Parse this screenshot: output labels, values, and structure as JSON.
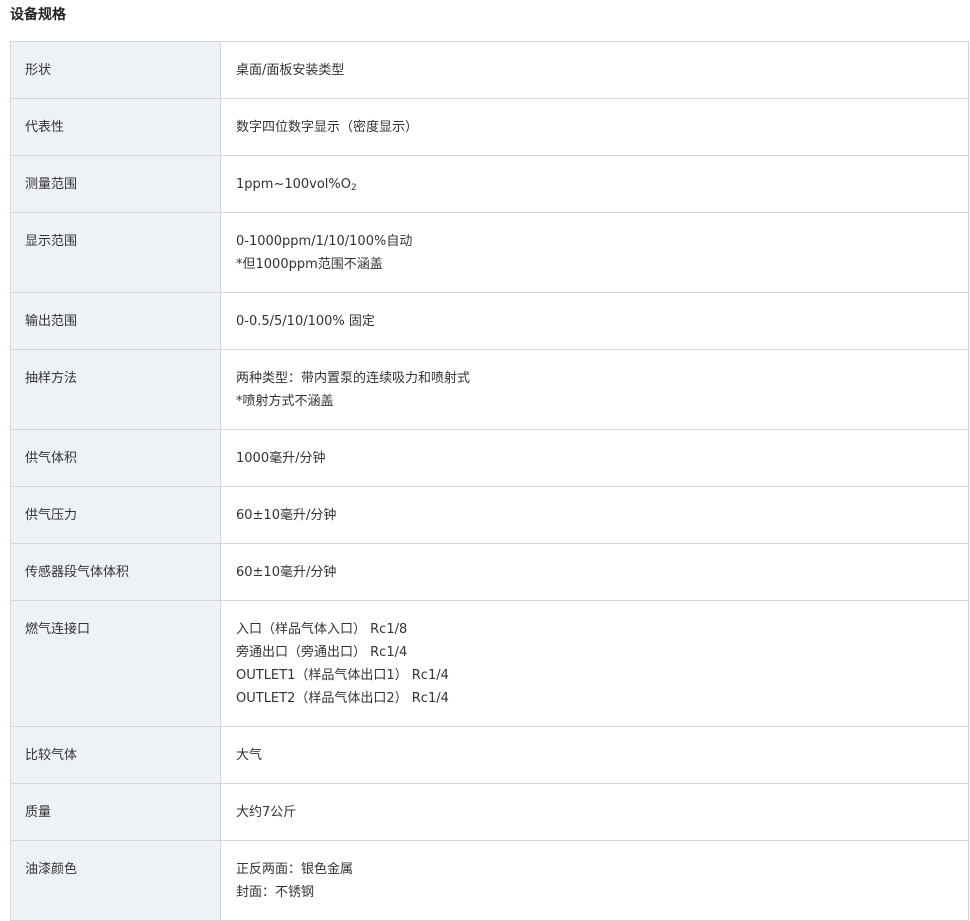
{
  "page_title": "设备规格",
  "rows": [
    {
      "label": "形状",
      "lines": [
        "桌面/面板安装类型"
      ]
    },
    {
      "label": "代表性",
      "lines": [
        "数字四位数字显示（密度显示）"
      ]
    },
    {
      "label": "测量范围",
      "value_main": "1ppm~100vol%O",
      "value_sub": "2"
    },
    {
      "label": "显示范围",
      "lines": [
        "0-1000ppm/1/10/100%自动",
        "*但1000ppm范围不涵盖"
      ]
    },
    {
      "label": "输出范围",
      "lines": [
        "0-0.5/5/10/100% 固定"
      ]
    },
    {
      "label": "抽样方法",
      "lines": [
        "两种类型：带内置泵的连续吸力和喷射式",
        "*喷射方式不涵盖"
      ]
    },
    {
      "label": "供气体积",
      "lines": [
        "1000毫升/分钟"
      ]
    },
    {
      "label": "供气压力",
      "lines": [
        "60±10毫升/分钟"
      ]
    },
    {
      "label": "传感器段气体体积",
      "lines": [
        "60±10毫升/分钟"
      ]
    },
    {
      "label": "燃气连接口",
      "lines": [
        "入口（样品气体入口） Rc1/8",
        "旁通出口（旁通出口） Rc1/4",
        "OUTLET1（样品气体出口1） Rc1/4",
        "OUTLET2（样品气体出口2） Rc1/4"
      ]
    },
    {
      "label": "比较气体",
      "lines": [
        "大气"
      ]
    },
    {
      "label": "质量",
      "lines": [
        "大约7公斤"
      ]
    },
    {
      "label": "油漆颜色",
      "lines": [
        "正反两面：银色金属",
        "封面：不锈钢"
      ]
    }
  ]
}
